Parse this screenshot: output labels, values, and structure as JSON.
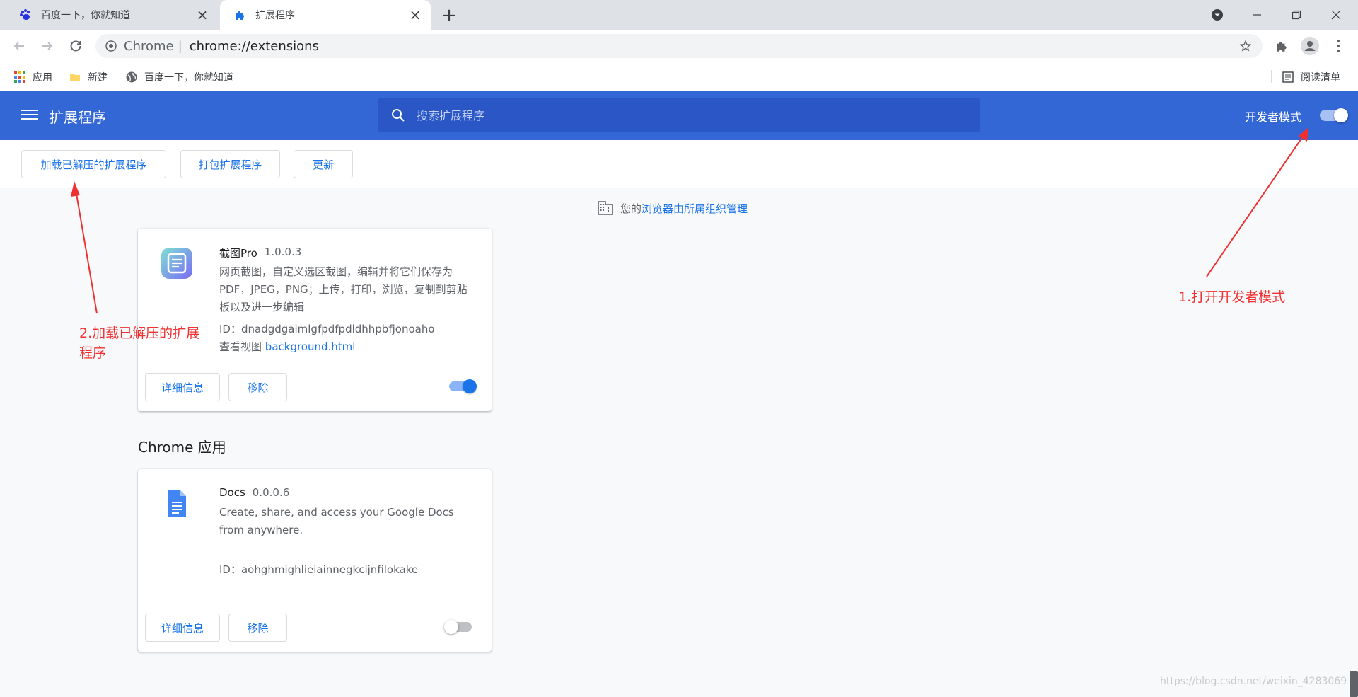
{
  "tabs": [
    {
      "title": "百度一下，你就知道",
      "icon": "baidu-paw-icon"
    },
    {
      "title": "扩展程序",
      "icon": "puzzle-piece-icon"
    }
  ],
  "omnibox": {
    "scheme": "Chrome",
    "path": "chrome://extensions"
  },
  "bookmarks": [
    {
      "label": "应用",
      "icon": "apps-grid-icon"
    },
    {
      "label": "新建",
      "icon": "folder-icon"
    },
    {
      "label": "百度一下，你就知道",
      "icon": "globe-icon"
    }
  ],
  "reading_list": "阅读清单",
  "header": {
    "title": "扩展程序",
    "search_placeholder": "搜索扩展程序",
    "dev_mode_label": "开发者模式",
    "dev_mode_on": true
  },
  "actions": {
    "load_unpacked": "加载已解压的扩展程序",
    "pack": "打包扩展程序",
    "update": "更新"
  },
  "managed": {
    "prefix": "您的",
    "link": "浏览器由所属组织管理"
  },
  "extensions": [
    {
      "name": "截图Pro",
      "version": "1.0.0.3",
      "description": "网页截图，自定义选区截图，编辑并将它们保存为PDF，JPEG，PNG；上传，打印，浏览，复制到剪贴板以及进一步编辑",
      "id": "ID：dnadgdgaimlgfpdfpdldhhpbfjonoaho",
      "views_label": "查看视图",
      "views_link": "background.html",
      "details": "详细信息",
      "remove": "移除",
      "enabled": true
    }
  ],
  "apps_section": "Chrome 应用",
  "apps": [
    {
      "name": "Docs",
      "version": "0.0.0.6",
      "description": "Create, share, and access your Google Docs from anywhere.",
      "id": "ID：aohghmighlieiainnegkcijnfilokake",
      "details": "详细信息",
      "remove": "移除",
      "enabled": false
    }
  ],
  "annotations": {
    "step1": "1.打开开发者模式",
    "step2_line1": "2.加载已解压的扩展",
    "step2_line2": "程序"
  },
  "watermark": "https://blog.csdn.net/weixin_4283069",
  "colors": {
    "accent": "#3367d6",
    "link": "#1a73e8",
    "annotation": "#f03030"
  }
}
